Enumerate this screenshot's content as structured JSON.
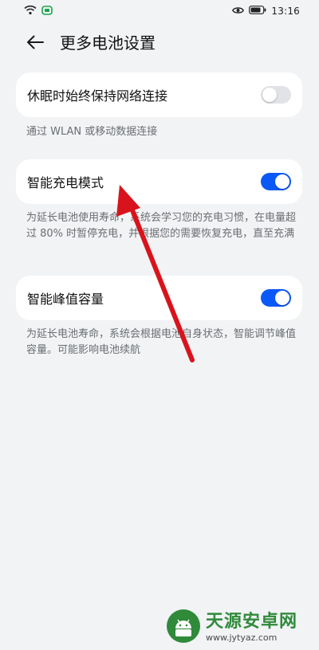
{
  "status_bar": {
    "time": "13:16",
    "left_icons": [
      "wifi-icon",
      "battery-saver-icon"
    ],
    "right_icons": [
      "eye-icon",
      "battery-icon"
    ]
  },
  "header": {
    "back_icon": "arrow-left-icon",
    "title": "更多电池设置"
  },
  "settings": [
    {
      "label": "休眠时始终保持网络连接",
      "enabled": false,
      "description": "通过 WLAN 或移动数据连接"
    },
    {
      "label": "智能充电模式",
      "enabled": true,
      "description": "为延长电池使用寿命，系统会学习您的充电习惯，在电量超过 80% 时暂停充电，并根据您的需要恢复充电，直至充满"
    },
    {
      "label": "智能峰值容量",
      "enabled": true,
      "description": "为延长电池寿命，系统会根据电池自身状态，智能调节峰值容量。可能影响电池续航"
    }
  ],
  "colors": {
    "toggle_on": "#0a59f7",
    "toggle_off": "#e2e3e6",
    "background": "#f1f3f5",
    "annotation_arrow": "#d9131b"
  },
  "watermark": {
    "title": "天源安卓网",
    "url": "www.jytyaz.com",
    "icon": "android-logo-icon"
  }
}
